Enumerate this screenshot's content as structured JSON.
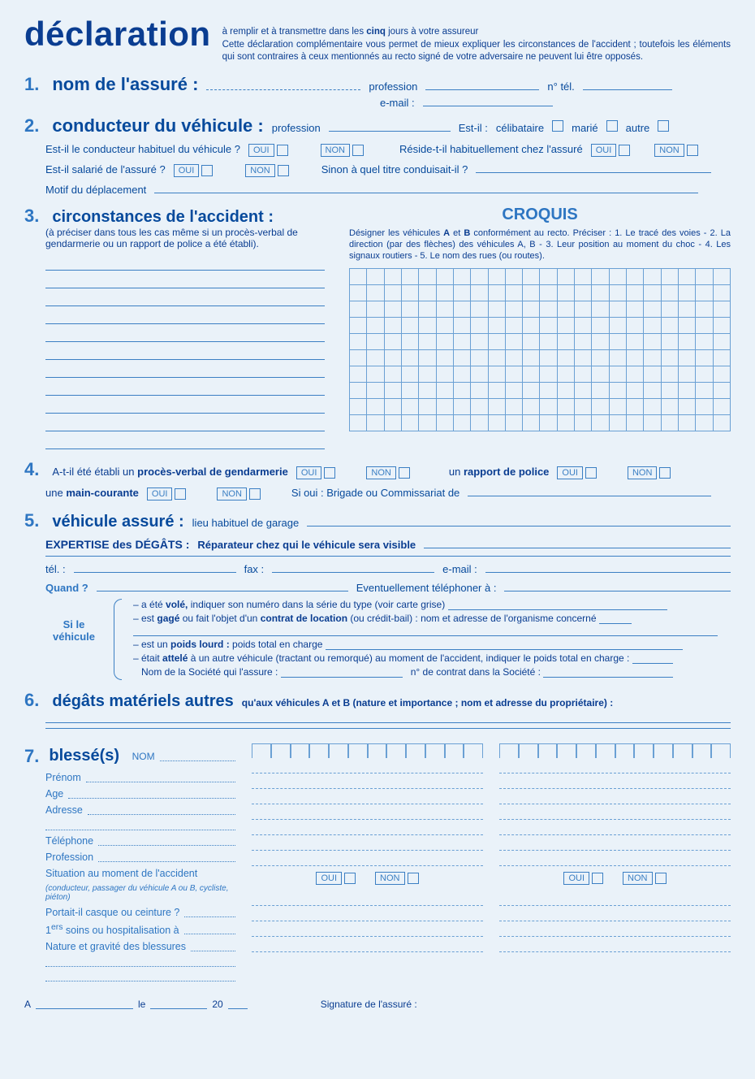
{
  "header": {
    "title": "déclaration",
    "sub1_pre": "à remplir et à transmettre dans les ",
    "sub1_bold": "cinq",
    "sub1_post": " jours à votre assureur",
    "sub2": "Cette déclaration complémentaire vous permet de mieux expliquer les circonstances de l'accident ; toutefois les éléments qui sont contraires à ceux mentionnés au recto signé de votre adversaire ne peuvent lui être opposés."
  },
  "oui": "OUI",
  "non": "NON",
  "s1": {
    "num": "1.",
    "title": "nom de l'assuré :",
    "profession": "profession",
    "tel": "n° tél.",
    "email": "e-mail :"
  },
  "s2": {
    "num": "2.",
    "title": "conducteur du véhicule :",
    "profession": "profession",
    "estil": "Est-il :",
    "celib": "célibataire",
    "marie": "marié",
    "autre": "autre",
    "q1": "Est-il le conducteur habituel du véhicule ?",
    "q2": "Réside-t-il habituellement chez l'assuré",
    "q3": "Est-il salarié de l'assuré ?",
    "q4": "Sinon à quel titre conduisait-il ?",
    "q5": "Motif du déplacement"
  },
  "s3": {
    "num": "3.",
    "title": "circonstances de l'accident :",
    "note": "(à préciser dans tous les cas même si un procès-verbal de gendarmerie ou un rapport de police a été établi).",
    "croquis": "CROQUIS",
    "ctxt_pre": "Désigner les véhicules ",
    "ctxt_A": "A",
    "ctxt_et": " et ",
    "ctxt_B": "B",
    "ctxt_post": " conformément au recto. Préciser : 1. Le tracé des voies - 2. La direction (par des flèches) des véhicules A, B - 3. Leur position au moment du choc - 4. Les signaux routiers - 5. Le nom des rues (ou routes)."
  },
  "s4": {
    "num": "4.",
    "q1_pre": "A-t-il été établi un ",
    "q1_b": "procès-verbal de gendarmerie",
    "rapport_pre": "un ",
    "rapport_b": "rapport de police",
    "mainc_pre": "une ",
    "mainc_b": "main-courante",
    "sioui": "Si oui : Brigade ou Commissariat de"
  },
  "s5": {
    "num": "5.",
    "title": "véhicule assuré :",
    "lieu": "lieu habituel de garage",
    "expertise": "EXPERTISE des DÉGÂTS :",
    "repar": "Réparateur chez qui le véhicule sera visible",
    "tel": "tél. :",
    "fax": "fax :",
    "email": "e-mail :",
    "quand": "Quand ?",
    "event": "Eventuellement téléphoner à :",
    "side1": "Si le",
    "side2": "véhicule",
    "l1_pre": "– a été ",
    "l1_b": "volé,",
    "l1_post": " indiquer son numéro dans la série du type (voir carte grise)",
    "l2_pre": "– est ",
    "l2_b": "gagé",
    "l2_mid": " ou fait l'objet d'un ",
    "l2_b2": "contrat de location",
    "l2_post": " (ou crédit-bail) : nom et adresse de l'organisme concerné",
    "l3_pre": "– est un ",
    "l3_b": "poids lourd :",
    "l3_post": " poids total en charge",
    "l4_pre": "– était ",
    "l4_b": "attelé",
    "l4_post": " à un autre véhicule (tractant ou remorqué) au moment de l'accident, indiquer le poids total en charge :",
    "l5a": "Nom de la Société qui l'assure :",
    "l5b": "n° de contrat dans la Société :"
  },
  "s6": {
    "num": "6.",
    "title": "dégâts matériels autres",
    "note": " qu'aux véhicules A et B (nature et importance ; nom et adresse du propriétaire) :"
  },
  "s7": {
    "num": "7.",
    "title": "blessé(s)",
    "nom": "NOM",
    "prenom": "Prénom",
    "age": "Age",
    "adresse": "Adresse",
    "telephone": "Téléphone",
    "profession": "Profession",
    "situation": "Situation au moment de l'accident",
    "situationNote": "(conducteur, passager du véhicule A ou B, cycliste, piéton)",
    "casque": "Portait-il casque ou ceinture ?",
    "soins_sup": "ers",
    "soins": "1   soins ou hospitalisation à",
    "nature": "Nature et gravité des blessures"
  },
  "footer": {
    "a": "A",
    "le": "le",
    "y20": "20",
    "sig": "Signature de l'assuré :"
  }
}
